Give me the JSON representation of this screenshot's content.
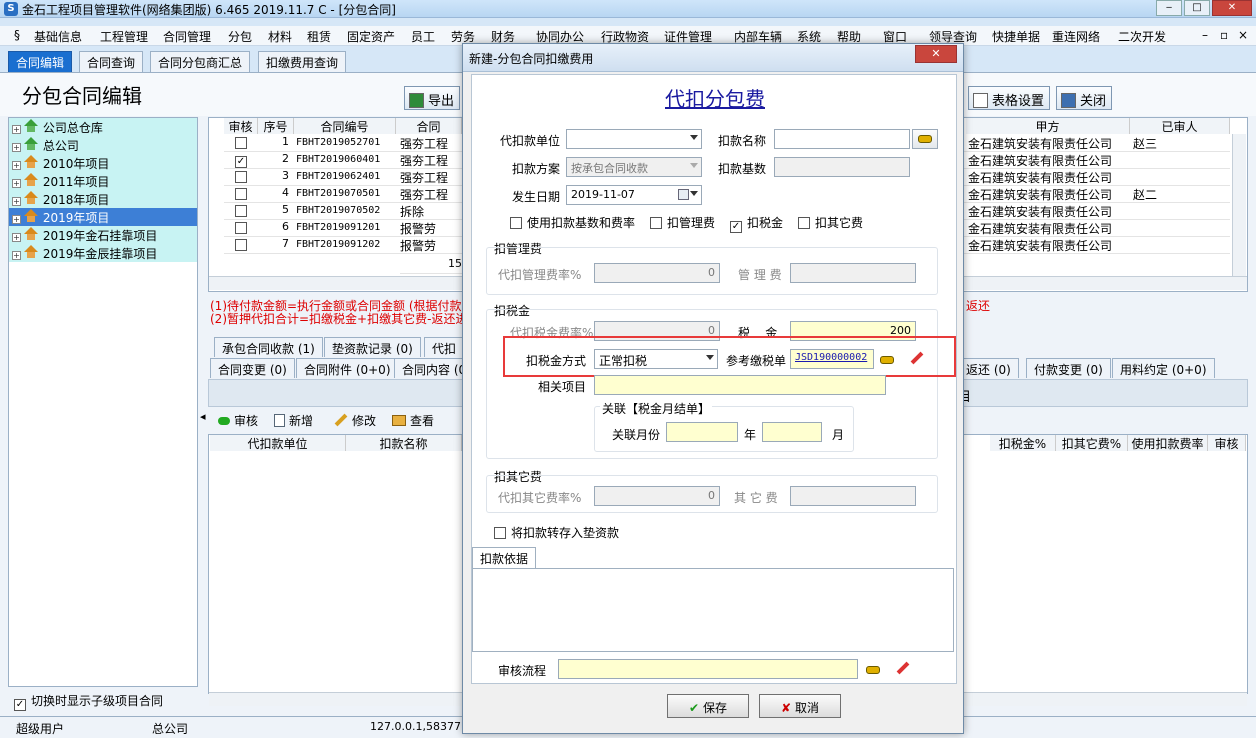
{
  "window": {
    "title": "金石工程项目管理软件(网络集团版) 6.465  2019.11.7 C - [分包合同]"
  },
  "menu": [
    "基础信息",
    "工程管理",
    "合同管理",
    "分包",
    "材料",
    "租赁",
    "固定资产",
    "员工",
    "劳务",
    "财务",
    "协同办公",
    "行政物资",
    "证件管理",
    "内部车辆",
    "系统",
    "帮助",
    "窗口",
    "领导查询",
    "快捷单据",
    "重连网络",
    "二次开发"
  ],
  "tabs": [
    "合同编辑",
    "合同查询",
    "合同分包商汇总",
    "扣缴费用查询"
  ],
  "page": {
    "title": "分包合同编辑",
    "export_label": "导出",
    "table_settings_label": "表格设置",
    "close_label": "关闭"
  },
  "tree": {
    "items": [
      "公司总仓库",
      "总公司",
      "2010年项目",
      "2011年项目",
      "2018年项目",
      "2019年项目",
      "2019年金石挂靠项目",
      "2019年金辰挂靠项目"
    ],
    "show_sub_label": "切换时显示子级项目合同"
  },
  "grid": {
    "headers": {
      "audit": "审核",
      "seq": "序号",
      "code": "合同编号",
      "name": "合同",
      "party_a": "甲方",
      "auditor": "已审人"
    },
    "rows": [
      {
        "checked": false,
        "seq": "1",
        "code": "FBHT2019052701",
        "name": "强夯工程",
        "party_a": "金石建筑安装有限责任公司",
        "auditor": "赵三"
      },
      {
        "checked": true,
        "seq": "2",
        "code": "FBHT2019060401",
        "name": "强夯工程",
        "party_a": "金石建筑安装有限责任公司",
        "auditor": ""
      },
      {
        "checked": false,
        "seq": "3",
        "code": "FBHT2019062401",
        "name": "强夯工程",
        "party_a": "金石建筑安装有限责任公司",
        "auditor": ""
      },
      {
        "checked": false,
        "seq": "4",
        "code": "FBHT2019070501",
        "name": "强夯工程",
        "party_a": "金石建筑安装有限责任公司",
        "auditor": "赵二"
      },
      {
        "checked": false,
        "seq": "5",
        "code": "FBHT2019070502",
        "name": "拆除",
        "party_a": "金石建筑安装有限责任公司",
        "auditor": ""
      },
      {
        "checked": false,
        "seq": "6",
        "code": "FBHT2019091201",
        "name": "报警劳",
        "party_a": "金石建筑安装有限责任公司",
        "auditor": ""
      },
      {
        "checked": false,
        "seq": "7",
        "code": "FBHT2019091202",
        "name": "报警劳",
        "party_a": "金石建筑安装有限责任公司",
        "auditor": ""
      }
    ],
    "footer_value": "15"
  },
  "notes": [
    "(1)待付款金额=执行金额或合同金额 (根据付款基",
    "(2)暂押代扣合计=扣缴税金+扣缴其它费-返还进",
    "返还"
  ],
  "lower_tabs_row1": [
    "承包合同收款 (1)",
    "垫资款记录 (0)",
    "代扣"
  ],
  "lower_tabs_row2": [
    "合同变更 (0)",
    "合同附件 (0+0)",
    "合同内容 (0"
  ],
  "lower_tabs_right": [
    "返还 (0)",
    "付款变更 (0)",
    "用料约定 (0+0)"
  ],
  "lower_section_label": "目",
  "lower_toolbar": {
    "audit": "审核",
    "new": "新增",
    "edit": "修改",
    "view": "查看"
  },
  "lower_grid": {
    "headers_left": [
      "代扣款单位",
      "扣款名称"
    ],
    "headers_right": [
      "扣税金%",
      "扣其它费%",
      "使用扣款费率",
      "审核"
    ]
  },
  "status": {
    "user": "超级用户",
    "company": "总公司",
    "ip": "127.0.0.1,58377"
  },
  "dialog": {
    "title": "新建-分包合同扣缴费用",
    "heading": "代扣分包费",
    "labels": {
      "unit": "代扣款单位",
      "deduct_name": "扣款名称",
      "scheme": "扣款方案",
      "base": "扣款基数",
      "date": "发生日期",
      "use_rate": "使用扣款基数和费率",
      "mgmt": "扣管理费",
      "tax": "扣税金",
      "other": "扣其它费"
    },
    "values": {
      "unit": "",
      "deduct_name": "",
      "scheme": "按承包合同收款",
      "base": "",
      "date": "2019-11-07"
    },
    "checks": {
      "use_rate": false,
      "mgmt": false,
      "tax": true,
      "other": false
    },
    "mgmt_section": {
      "title": "扣管理费",
      "rate_label": "代扣管理费率%",
      "rate": "0",
      "fee_label": "管 理 费",
      "fee": ""
    },
    "tax_section": {
      "title": "扣税金",
      "rate_label": "代扣税金费率%",
      "rate": "0",
      "tax_label": "税    金",
      "tax": "200",
      "method_label": "扣税金方式",
      "method": "正常扣税",
      "ref_label": "参考缴税单",
      "ref": "JSD190000002",
      "project_label": "相关项目",
      "project": "",
      "link_title": "关联【税金月结单】",
      "month_label": "关联月份",
      "year_unit": "年",
      "month_unit": "月"
    },
    "other_section": {
      "title": "扣其它费",
      "rate_label": "代扣其它费率%",
      "rate": "0",
      "fee_label": "其 它 费",
      "fee": ""
    },
    "transfer_label": "将扣款转存入垫资款",
    "basis_tab": "扣款依据",
    "workflow_label": "审核流程",
    "save": "保存",
    "cancel": "取消"
  }
}
